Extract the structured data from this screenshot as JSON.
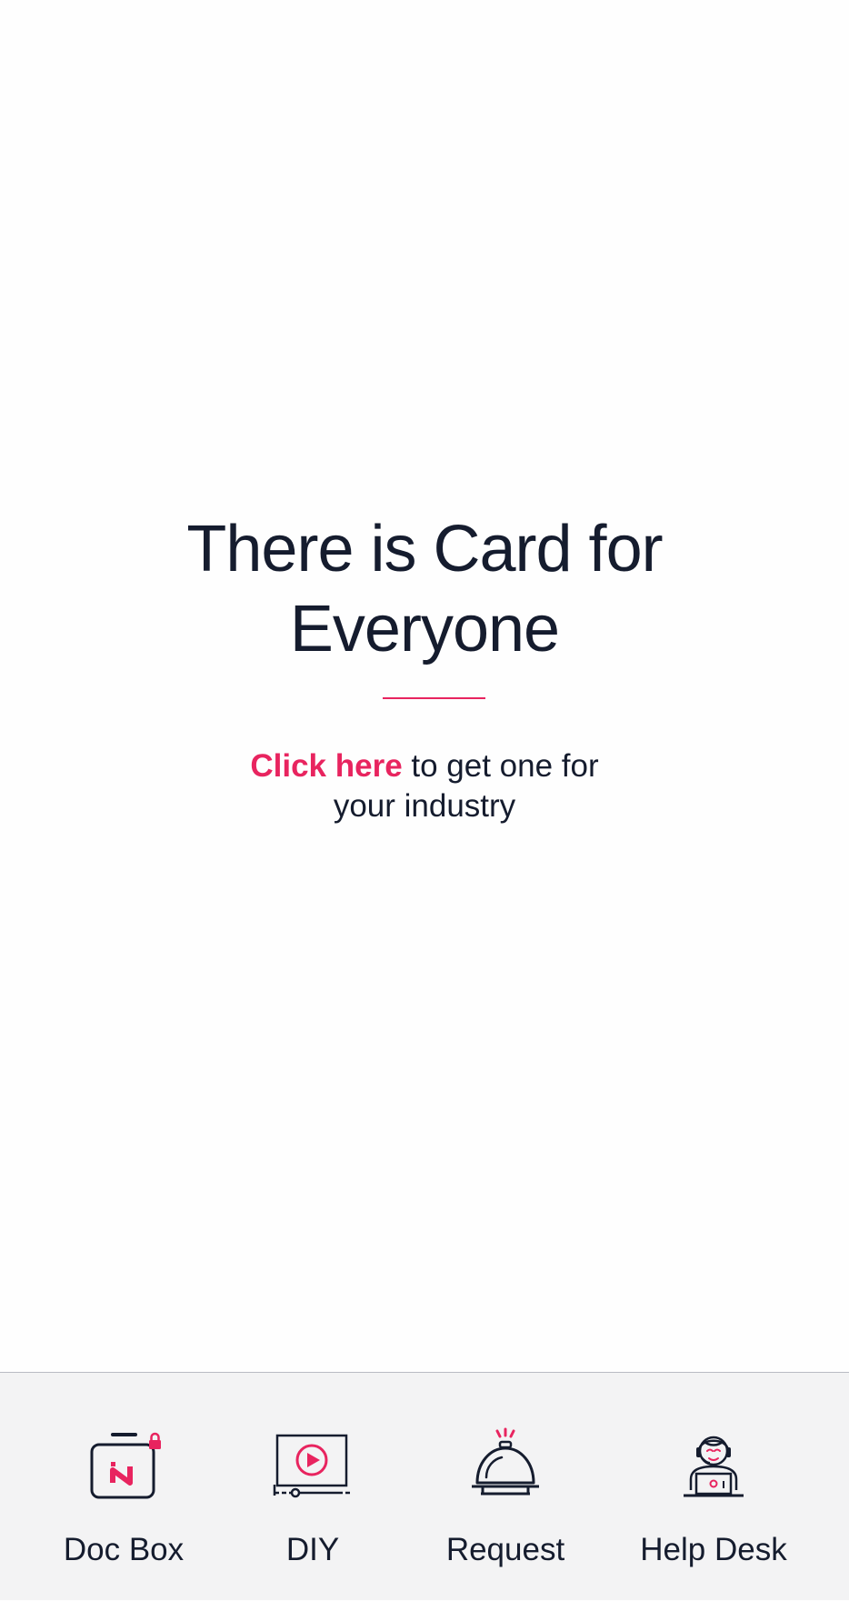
{
  "hero": {
    "title_line1": "There is Card for",
    "title_line2": "Everyone",
    "cta_link": "Click here",
    "cta_text_line1": " to get one for",
    "cta_text_line2": "your industry"
  },
  "tabbar": {
    "items": [
      {
        "label": "Doc Box",
        "icon": "doc-box-icon"
      },
      {
        "label": "DIY",
        "icon": "video-play-icon"
      },
      {
        "label": "Request",
        "icon": "service-bell-icon"
      },
      {
        "label": "Help Desk",
        "icon": "support-agent-icon"
      }
    ]
  },
  "colors": {
    "accent": "#e8245f",
    "text": "#151c2e",
    "tabbar_bg": "#f3f3f4",
    "background": "#fefefe"
  }
}
